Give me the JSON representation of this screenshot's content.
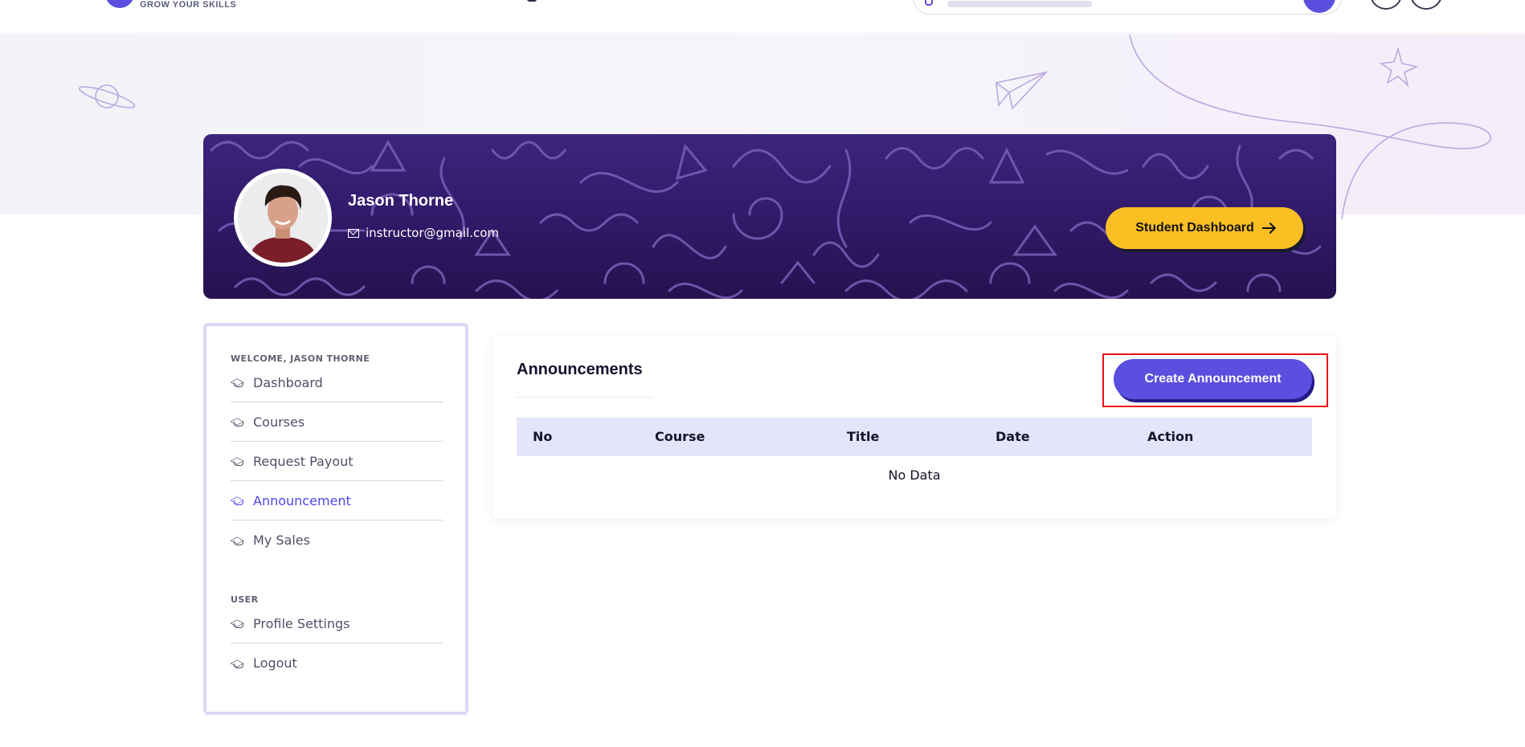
{
  "header": {
    "tagline": "GROW YOUR SKILLS"
  },
  "profile": {
    "name": "Jason Thorne",
    "email": "instructor@gmail.com",
    "student_dashboard_label": "Student Dashboard"
  },
  "sidebar": {
    "welcome_heading": "WELCOME, JASON THORNE",
    "items": [
      {
        "label": "Dashboard",
        "icon": "graduation-cap-icon",
        "active": false
      },
      {
        "label": "Courses",
        "icon": "graduation-cap-icon",
        "active": false
      },
      {
        "label": "Request Payout",
        "icon": "graduation-cap-icon",
        "active": false
      },
      {
        "label": "Announcement",
        "icon": "graduation-cap-icon",
        "active": true
      },
      {
        "label": "My Sales",
        "icon": "graduation-cap-icon",
        "active": false
      }
    ],
    "user_heading": "USER",
    "user_items": [
      {
        "label": "Profile Settings",
        "icon": "graduation-cap-icon"
      },
      {
        "label": "Logout",
        "icon": "graduation-cap-icon"
      }
    ]
  },
  "main": {
    "title": "Announcements",
    "create_button_label": "Create Announcement",
    "table": {
      "columns": [
        "No",
        "Course",
        "Title",
        "Date",
        "Action"
      ],
      "empty_text": "No Data"
    }
  },
  "colors": {
    "primary": "#5b4fe0",
    "accent_yellow": "#fbbf24",
    "banner": "#321b6c",
    "active_text": "#4f46e5",
    "highlight": "#ec0f16"
  }
}
